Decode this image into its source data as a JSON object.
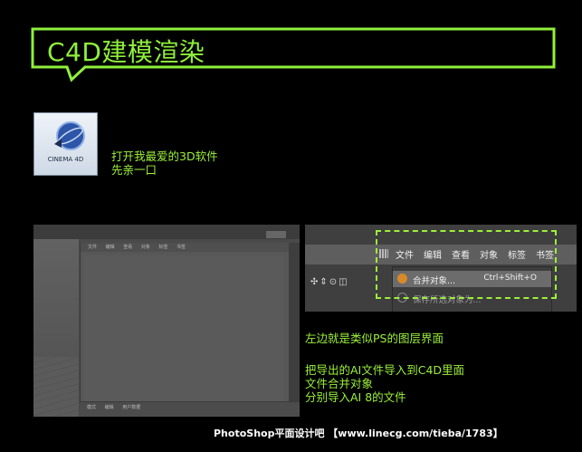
{
  "title": "C4D建模渲染",
  "app_icon": {
    "name": "cinema4d-icon",
    "label": "CINEMA 4D"
  },
  "intro_lines": [
    "打开我最爱的3D软件",
    "先亲一口"
  ],
  "editor": {
    "panel_menu": [
      "文件",
      "编辑",
      "查看",
      "对象",
      "标签",
      "书签"
    ],
    "bottom_menu": [
      "模式",
      "编辑",
      "用户数据"
    ]
  },
  "menubar": [
    "文件",
    "编辑",
    "查看",
    "对象",
    "标签",
    "书签"
  ],
  "dropdown": [
    {
      "label": "合并对象...",
      "shortcut": "Ctrl+Shift+O"
    },
    {
      "label": "保存所选对象为...",
      "shortcut": ""
    }
  ],
  "notes": {
    "line1": "左边就是类似PS的图层界面",
    "line2": "把导出的AI文件导入到C4D里面",
    "line3": "文件合并对象",
    "line4": "分别导入AI 8的文件"
  },
  "footer": "PhotoShop平面设计吧 【www.linecg.com/tieba/1783】",
  "colors": {
    "accent": "#9cf03a",
    "background": "#000000"
  }
}
